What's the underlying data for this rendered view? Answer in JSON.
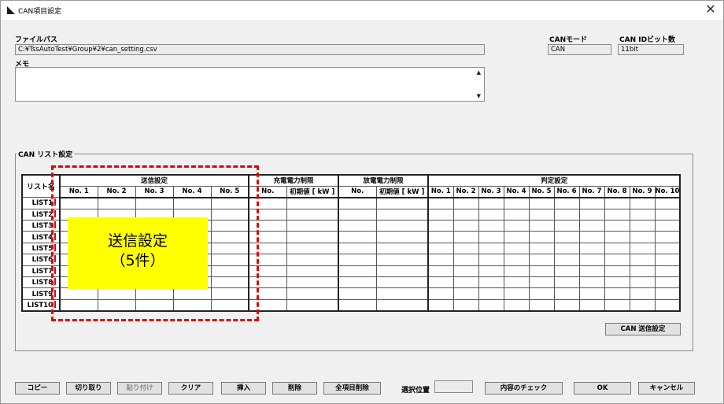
{
  "window": {
    "title": "CAN項目設定"
  },
  "file_path": {
    "label": "ファイルパス",
    "value": "C:¥TssAutoTest¥Group¥2¥can_setting.csv"
  },
  "memo": {
    "label": "メモ",
    "value": ""
  },
  "can_mode": {
    "label": "CANモード",
    "value": "CAN"
  },
  "can_id_bits": {
    "label": "CAN IDビット数",
    "value": "11bit"
  },
  "list_group": {
    "title": "CAN リスト設定",
    "header": {
      "list_name": "リスト名",
      "send": "送信設定",
      "charge": "充電電力制限",
      "discharge": "放電電力制限",
      "judge": "判定設定",
      "send_cols": [
        "No. 1",
        "No. 2",
        "No. 3",
        "No. 4",
        "No. 5"
      ],
      "charge_cols": [
        "No.",
        "初期値 [ kW ]"
      ],
      "discharge_cols": [
        "No.",
        "初期値 [ kW ]"
      ],
      "judge_cols": [
        "No. 1",
        "No. 2",
        "No. 3",
        "No. 4",
        "No. 5",
        "No. 6",
        "No. 7",
        "No. 8",
        "No. 9",
        "No. 10"
      ]
    },
    "rows": [
      "LIST1",
      "LIST2",
      "LIST3",
      "LIST4",
      "LIST5",
      "LIST6",
      "LIST7",
      "LIST8",
      "LIST9",
      "LIST10"
    ],
    "can_send_button": "CAN 送信設定"
  },
  "callout": {
    "line1": "送信設定",
    "line2": "（5件）"
  },
  "selected_position": {
    "label": "選択位置",
    "value": ""
  },
  "buttons": {
    "copy": "コピー",
    "cut": "切り取り",
    "paste": "貼り付け",
    "clear": "クリア",
    "insert": "挿入",
    "delete": "削除",
    "delete_all": "全項目削除",
    "check": "内容のチェック",
    "ok": "OK",
    "cancel": "キャンセル"
  }
}
